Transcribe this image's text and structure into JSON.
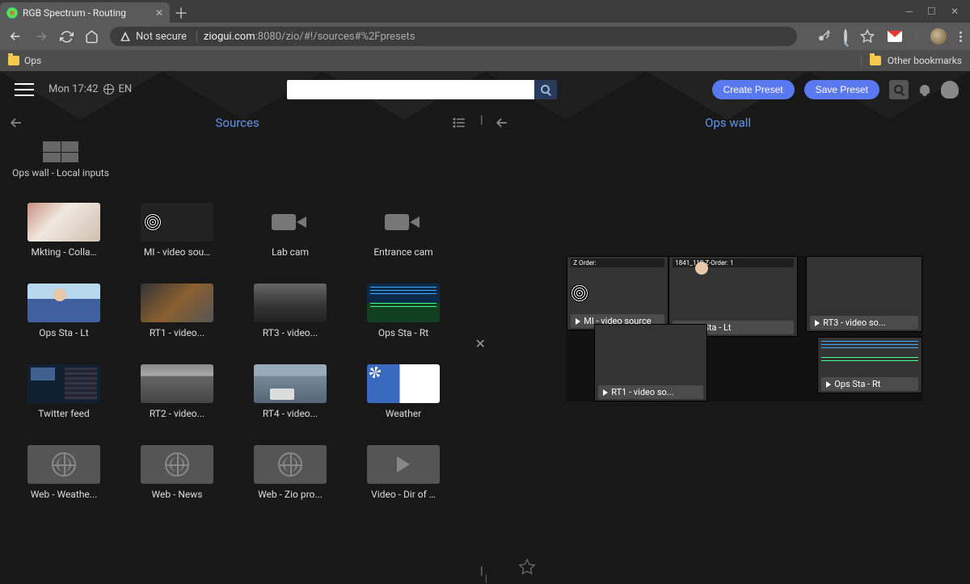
{
  "browser": {
    "tab_title": "RGB Spectrum - Routing",
    "secure_label": "Not secure",
    "url_host": "ziogui.com",
    "url_path": ":8080/zio/#!/sources#%2Fpresets"
  },
  "bookmarks": {
    "ops": "Ops",
    "other": "Other bookmarks"
  },
  "header": {
    "clock": "Mon 17:42",
    "lang": "EN",
    "create_preset": "Create Preset",
    "save_preset": "Save Preset",
    "search_placeholder": ""
  },
  "left_panel": {
    "title": "Sources",
    "group_label": "Ops wall - Local inputs"
  },
  "right_panel": {
    "title": "Ops wall"
  },
  "sources": [
    {
      "label": "Mkting - Colla…",
      "thumb": "t-people"
    },
    {
      "label": "MI - video sou…",
      "thumb": "t-pluto"
    },
    {
      "label": "Lab cam",
      "thumb": "cam"
    },
    {
      "label": "Entrance cam",
      "thumb": "cam"
    },
    {
      "label": "Ops Sta - Lt",
      "thumb": "t-man"
    },
    {
      "label": "RT1 - video...",
      "thumb": "t-fire"
    },
    {
      "label": "RT3 - video...",
      "thumb": "t-subway"
    },
    {
      "label": "Ops Sta - Rt",
      "thumb": "t-trading"
    },
    {
      "label": "Twitter feed",
      "thumb": "t-twitter"
    },
    {
      "label": "RT2 - video...",
      "thumb": "t-garage"
    },
    {
      "label": "RT4 - video...",
      "thumb": "t-street"
    },
    {
      "label": "Weather",
      "thumb": "t-weather"
    },
    {
      "label": "Web - Weathe...",
      "thumb": "globe"
    },
    {
      "label": "Web - News",
      "thumb": "globe"
    },
    {
      "label": "Web - Zio pro...",
      "thumb": "globe"
    },
    {
      "label": "Video - Dir of …",
      "thumb": "play"
    }
  ],
  "wall_windows": [
    {
      "label": "MI - video source",
      "thumb": "t-pluto",
      "meta": "Z Order:",
      "style": "top:0;left:0;width:126px;height:92px;"
    },
    {
      "label": "Ops Sta - Lt",
      "thumb": "t-man",
      "meta": "1841_118  Z-Order: 1",
      "style": "top:0;left:126px;width:160px;height:100px;"
    },
    {
      "label": "RT1 - video so...",
      "thumb": "t-fire",
      "meta": "",
      "style": "top:84px;left:34px;width:140px;height:96px;"
    },
    {
      "label": "RT3 - video so...",
      "thumb": "t-subway",
      "meta": "",
      "style": "top:0;left:296px;width:144px;height:94px;"
    },
    {
      "label": "Ops Sta - Rt",
      "thumb": "t-trading",
      "meta": "",
      "style": "top:100px;left:310px;width:130px;height:70px;"
    }
  ]
}
